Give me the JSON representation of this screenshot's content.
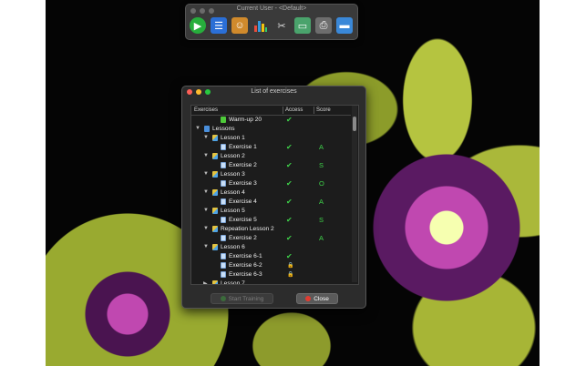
{
  "toolbar": {
    "title": "Current User - <Default>",
    "icons": [
      "play-icon",
      "list-icon",
      "users-icon",
      "bar-chart-icon",
      "tools-icon",
      "book-icon",
      "printer-icon",
      "folder-icon"
    ]
  },
  "dialog": {
    "title": "List of exercises",
    "columns": {
      "exercises": "Exercises",
      "access": "Access",
      "score": "Score"
    },
    "start_button": "Start Training",
    "close_button": "Close"
  },
  "rows": [
    {
      "label": "Warm-up 20",
      "level": 2,
      "type": "leaf",
      "access": "✔",
      "score": ""
    },
    {
      "label": "Lessons",
      "level": 0,
      "type": "folder",
      "access": "",
      "score": ""
    },
    {
      "label": "Lesson 1",
      "level": 1,
      "type": "lesson",
      "access": "",
      "score": ""
    },
    {
      "label": "Exercise 1",
      "level": 2,
      "type": "file",
      "access": "✔",
      "score": "A"
    },
    {
      "label": "Lesson 2",
      "level": 1,
      "type": "lesson",
      "access": "",
      "score": ""
    },
    {
      "label": "Exercise 2",
      "level": 2,
      "type": "file",
      "access": "✔",
      "score": "S"
    },
    {
      "label": "Lesson 3",
      "level": 1,
      "type": "lesson",
      "access": "",
      "score": ""
    },
    {
      "label": "Exercise 3",
      "level": 2,
      "type": "file",
      "access": "✔",
      "score": "O"
    },
    {
      "label": "Lesson 4",
      "level": 1,
      "type": "lesson",
      "access": "",
      "score": ""
    },
    {
      "label": "Exercise 4",
      "level": 2,
      "type": "file",
      "access": "✔",
      "score": "A"
    },
    {
      "label": "Lesson 5",
      "level": 1,
      "type": "lesson",
      "access": "",
      "score": ""
    },
    {
      "label": "Exercise 5",
      "level": 2,
      "type": "file",
      "access": "✔",
      "score": "S"
    },
    {
      "label": "Repeation Lesson 2",
      "level": 1,
      "type": "lesson",
      "access": "",
      "score": ""
    },
    {
      "label": "Exercise 2",
      "level": 2,
      "type": "file",
      "access": "✔",
      "score": "A"
    },
    {
      "label": "Lesson 6",
      "level": 1,
      "type": "lesson",
      "access": "",
      "score": ""
    },
    {
      "label": "Exercise 6-1",
      "level": 2,
      "type": "file",
      "access": "✔",
      "score": ""
    },
    {
      "label": "Exercise 6-2",
      "level": 2,
      "type": "file",
      "access": "lock",
      "score": ""
    },
    {
      "label": "Exercise 6-3",
      "level": 2,
      "type": "file",
      "access": "lock",
      "score": ""
    },
    {
      "label": "Lesson 7",
      "level": 1,
      "type": "lesson-collapsed",
      "access": "",
      "score": ""
    }
  ]
}
